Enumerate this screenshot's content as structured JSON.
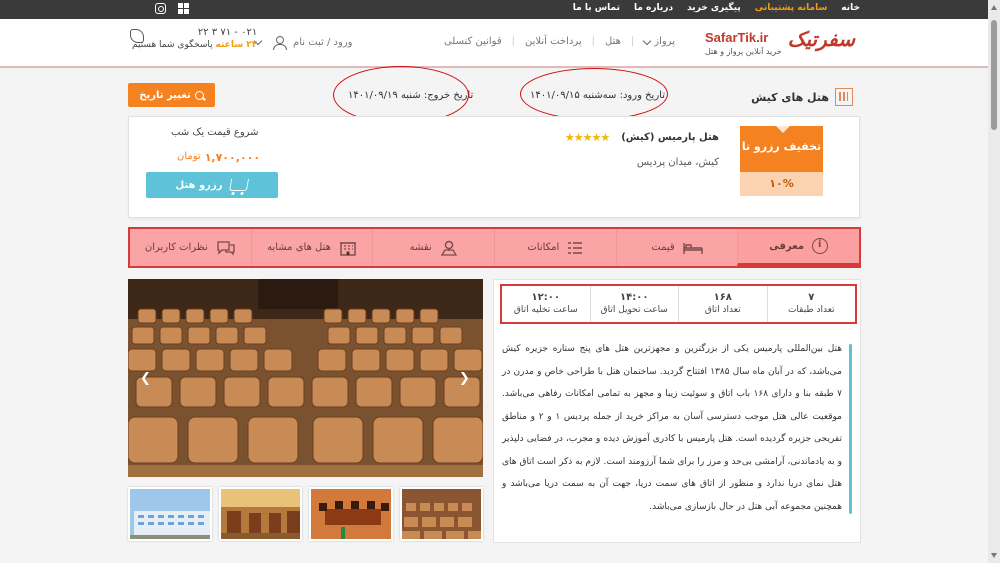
{
  "topbar": {
    "links": [
      "خانه",
      "سامانه پشتیبانی",
      "پیگیری خرید",
      "درباره ما",
      "تماس با ما"
    ],
    "active_index": 1
  },
  "header": {
    "logo_mark": "سفرتیک",
    "brand": "SafarTik.ir",
    "tagline": "خرید آنلاین پرواز و هتل",
    "nav": [
      "پرواز",
      "هتل",
      "پرداخت آنلاین",
      "قوانین کنسلی"
    ],
    "login": "ورود / ثبت نام",
    "phone": "۰۲۱ - ۷۱ ۳ ۲۲",
    "hours_strong": "۲۴ ساعته",
    "hours_rest": "پاسخگوی شما هستیم"
  },
  "info": {
    "hotels_title": "هتل های کیش",
    "checkin": "تاریخ ورود: سه‌شنبه ۱۴۰۱/۰۹/۱۵",
    "checkout": "تاریخ خروج: شنبه ۱۴۰۱/۰۹/۱۹",
    "change_date": "تغییر تاریخ"
  },
  "card": {
    "discount_title": "تخفیف رزرو تا",
    "discount_pct": "۱۰%",
    "hotel_name": "هتل پارمیس (کیش)",
    "stars": "★★★★★",
    "address": "کیش، میدان پردیس",
    "price_label": "شروع قیمت یک شب",
    "price": "۱,۷۰۰,۰۰۰",
    "price_unit": "تومان",
    "reserve": "رزرو هتل"
  },
  "tabs": [
    {
      "label": "معرفی",
      "icon": "info-icon"
    },
    {
      "label": "قیمت",
      "icon": "bed-icon"
    },
    {
      "label": "امکانات",
      "icon": "list-icon"
    },
    {
      "label": "نقشه",
      "icon": "map-icon"
    },
    {
      "label": "هتل های مشابه",
      "icon": "building-icon"
    },
    {
      "label": "نظرات کاربران",
      "icon": "chat-icon"
    }
  ],
  "facts": [
    {
      "value": "۷",
      "label": "تعداد طبقات"
    },
    {
      "value": "۱۶۸",
      "label": "تعداد اتاق"
    },
    {
      "value": "۱۴:۰۰",
      "label": "ساعت تحویل اتاق"
    },
    {
      "value": "۱۲:۰۰",
      "label": "ساعت تخلیه اتاق"
    }
  ],
  "description": "هتل بین‌المللی پارمیس یکی از بزرگترین و مجهزترین هتل های پنج ستاره جزیره کیش می‌باشد، که در آبان ماه سال ۱۳۸۵ افتتاح گردید. ساختمان هتل با طراحی خاص و مدرن در ۷ طبقه بنا و دارای ۱۶۸ باب اتاق و سوئیت زیبا و مجهز به تمامی امکانات رفاهی می‌باشد. موقعیت عالی هتل موجب دسترسی آسان به مراکز خرید از جمله پردیس ۱ و ۲ و مناطق تفریحی جزیره گردیده است. هتل پارمیس با کادری آموزش دیده و مجرب، در فضایی دلپذیر و به یادماندنی، آرامشی بی‌حد و مرز را برای شما آرزومند است. لازم به ذکر است اتاق های هتل نمای دریا ندارد و منظور از اتاق های سمت دریا، جهت آن به سمت دریا می‌باشد و همچنین مجموعه آبی هتل در حال بازسازی می‌باشد."
}
